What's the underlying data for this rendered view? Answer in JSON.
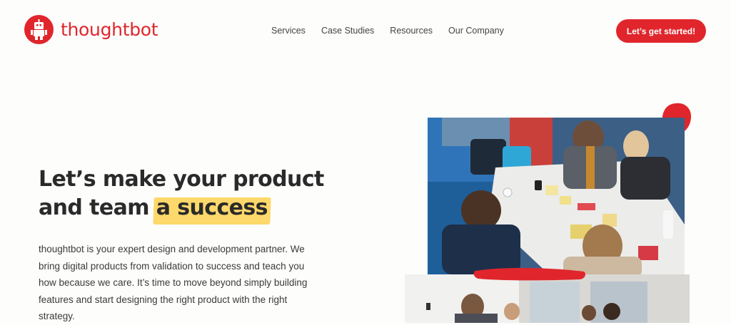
{
  "brand": {
    "name": "thoughtbot",
    "accent": "#e0262c"
  },
  "nav": {
    "items": [
      "Services",
      "Case Studies",
      "Resources",
      "Our Company"
    ]
  },
  "cta": {
    "label": "Let’s get started!"
  },
  "hero": {
    "headline_line1": "Let’s make your product",
    "headline_line2_prefix": "and team ",
    "headline_highlight": "a success",
    "highlight_color": "#fdd86a",
    "description": "thoughtbot is your expert design and development partner. We bring digital products from validation to success and teach you how because we care. It’s time to move beyond simply building features and start designing the right product with the right strategy."
  }
}
